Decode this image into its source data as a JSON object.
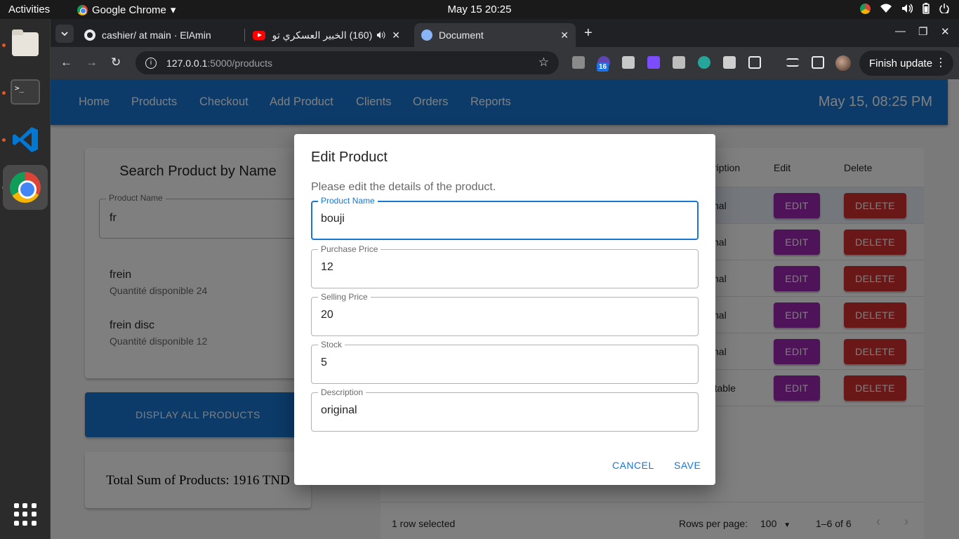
{
  "os": {
    "activities": "Activities",
    "app_name": "Google Chrome",
    "app_menu_arrow": "▾",
    "clock": "May 15  20:25",
    "tray_icons": [
      "chrome-icon",
      "wifi-icon",
      "volume-icon",
      "battery-icon",
      "power-icon"
    ],
    "dock_items": [
      "files",
      "terminal",
      "vscode",
      "chrome"
    ],
    "terminal_glyph": ">_"
  },
  "browser": {
    "tabs": [
      {
        "title": "cashier/ at main · ElAmin",
        "favicon": "github-icon"
      },
      {
        "title": "(160) الخبير العسكري تو",
        "favicon": "youtube-icon",
        "audio": true
      },
      {
        "title": "Document",
        "favicon": "globe-icon",
        "active": true
      }
    ],
    "url_host": "127.0.0.1",
    "url_path": ":5000/products",
    "extension_badge": "16",
    "finish_update": "Finish update"
  },
  "app": {
    "nav": [
      "Home",
      "Products",
      "Checkout",
      "Add Product",
      "Clients",
      "Orders",
      "Reports"
    ],
    "datetime": "May 15, 08:25 PM",
    "search": {
      "title": "Search Product by Name",
      "field_label": "Product Name",
      "field_value": "fr",
      "results": [
        {
          "name": "frein",
          "stock": "Quantité disponible 24"
        },
        {
          "name": "frein disc",
          "stock": "Quantité disponible 12"
        }
      ]
    },
    "display_all_label": "DISPLAY ALL PRODUCTS",
    "total_text": "Total Sum of Products: 1916 TND",
    "grid": {
      "columns": [
        "scription",
        "Edit",
        "Delete"
      ],
      "rows": [
        {
          "description": "iginal",
          "selected": true
        },
        {
          "description": "iginal"
        },
        {
          "description": "iginal"
        },
        {
          "description": "iginal"
        },
        {
          "description": "iginal"
        },
        {
          "description": "aptable"
        }
      ],
      "edit_label": "EDIT",
      "delete_label": "DELETE",
      "selection_text": "1 row selected",
      "rows_per_page_label": "Rows per page:",
      "rows_per_page_value": "100",
      "pagination_text": "1–6 of 6"
    }
  },
  "dialog": {
    "title": "Edit Product",
    "text": "Please edit the details of the product.",
    "fields": [
      {
        "label": "Product Name",
        "value": "bouji"
      },
      {
        "label": "Purchase Price",
        "value": "12"
      },
      {
        "label": "Selling Price",
        "value": "20"
      },
      {
        "label": "Stock",
        "value": "5"
      },
      {
        "label": "Description",
        "value": "original"
      }
    ],
    "cancel_label": "CANCEL",
    "save_label": "SAVE"
  },
  "colors": {
    "primary": "#1976d2",
    "edit": "#9c27b0",
    "delete": "#d32f2f"
  }
}
